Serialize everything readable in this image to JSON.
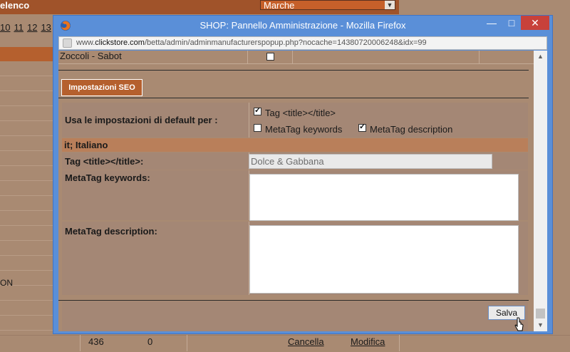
{
  "background": {
    "header_label": "elenco",
    "brand_select_value": "Marche",
    "pagination": [
      "10",
      "11",
      "12",
      "13"
    ],
    "side_fragment": "ON",
    "bottom_row": {
      "count": "436",
      "value": "0",
      "cancel_label": "Cancella",
      "edit_label": "Modifica"
    }
  },
  "window": {
    "title": "SHOP: Pannello Amministrazione - Mozilla Firefox",
    "url_prefix": "www.",
    "url_domain": "clickstore.com",
    "url_path": "/betta/admin/adminmanufacturerspopup.php?nocache=14380720006248&idx=99"
  },
  "form": {
    "top_row_label": "Zoccoli - Sabot",
    "seo_tab_label": "Impostazioni SEO",
    "defaults_label": "Usa le impostazioni di default per :",
    "options": {
      "title_tag": {
        "label": "Tag <title></title>",
        "checked": true
      },
      "meta_keywords": {
        "label": "MetaTag keywords",
        "checked": false
      },
      "meta_description": {
        "label": "MetaTag description",
        "checked": true
      }
    },
    "language_label": "it; Italiano",
    "title_tag_label": "Tag <title></title>:",
    "title_tag_value": "Dolce & Gabbana",
    "meta_keywords_label": "MetaTag keywords:",
    "meta_description_label": "MetaTag description:",
    "save_label": "Salva"
  },
  "colors": {
    "page_bg": "#a98a72",
    "accent_orange": "#b5602e",
    "window_frame": "#5a8fd8",
    "close_red": "#c8413a"
  }
}
